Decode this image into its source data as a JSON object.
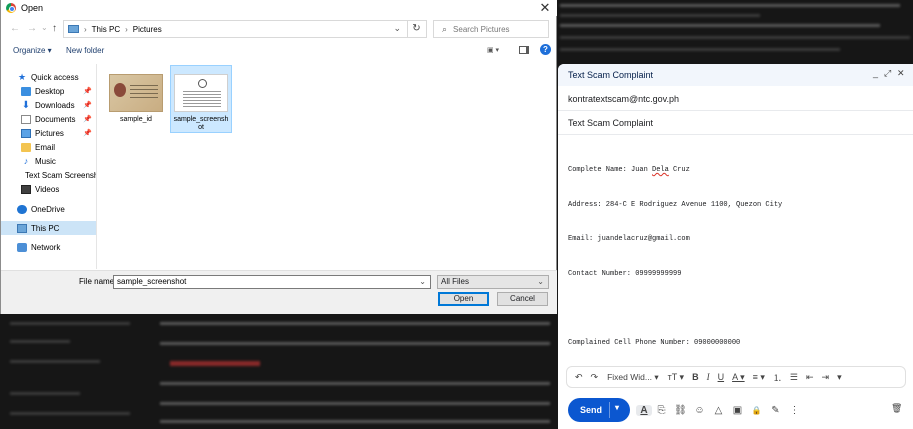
{
  "dialog": {
    "title": "Open",
    "close": "✕",
    "nav_back": "←",
    "nav_forward": "→",
    "nav_dropdown": "⌄",
    "nav_up": "↑",
    "breadcrumb": [
      "This PC",
      "Pictures"
    ],
    "breadcrumb_sep": "›",
    "address_dropdown": "⌄",
    "refresh": "↻",
    "search_placeholder": "Search Pictures",
    "organize": "Organize ▾",
    "new_folder": "New folder",
    "view_icon": "▣ ▾",
    "help": "?",
    "nav_items": [
      {
        "label": "Quick access",
        "icon": "star-icon",
        "glyph": "★",
        "pinned": false
      },
      {
        "label": "Desktop",
        "icon": "desktop-icon",
        "pinned": true
      },
      {
        "label": "Downloads",
        "icon": "download-icon",
        "glyph": "⬇",
        "pinned": true
      },
      {
        "label": "Documents",
        "icon": "documents-icon",
        "pinned": true
      },
      {
        "label": "Pictures",
        "icon": "pictures-icon",
        "pinned": true
      },
      {
        "label": "Email",
        "icon": "folder-icon",
        "pinned": false
      },
      {
        "label": "Music",
        "icon": "music-icon",
        "glyph": "♪",
        "pinned": false
      },
      {
        "label": "Text Scam Screensh",
        "icon": "folder-icon",
        "pinned": false
      },
      {
        "label": "Videos",
        "icon": "videos-icon",
        "pinned": false
      },
      {
        "label": "OneDrive",
        "icon": "cloud-icon",
        "pinned": false
      },
      {
        "label": "This PC",
        "icon": "pc-icon",
        "pinned": false,
        "selected": true
      },
      {
        "label": "Network",
        "icon": "network-icon",
        "pinned": false
      }
    ],
    "pin_glyph": "📌",
    "files": [
      {
        "name": "sample_id",
        "thumb": "id-card",
        "selected": false
      },
      {
        "name": "sample_screensh ot",
        "thumb": "screenshot",
        "selected": true
      }
    ],
    "filename_label": "File name:",
    "filename_value": "sample_screenshot",
    "filter_value": "All Files",
    "open_button": "Open",
    "cancel_button": "Cancel",
    "dropdown_glyph": "⌄"
  },
  "compose": {
    "title": "Text Scam Complaint",
    "minimize": "_",
    "expand": "⤢",
    "close": "✕",
    "to": "kontratextscam@ntc.gov.ph",
    "subject": "Text Scam Complaint",
    "body_lines": [
      {
        "pre": "Complete Name: Juan ",
        "flag": "Dela",
        "post": " Cruz"
      },
      {
        "pre": "Address: 284-C E Rodriguez Avenue 1100, Quezon City",
        "flag": "",
        "post": ""
      },
      {
        "pre": "Email: juandelacruz@gmail.com",
        "flag": "",
        "post": ""
      },
      {
        "pre": "Contact Number: 09999999999",
        "flag": "",
        "post": ""
      },
      {
        "pre": "",
        "flag": "",
        "post": ""
      },
      {
        "pre": "Complained Cell Phone Number: 09000000000",
        "flag": "",
        "post": ""
      }
    ],
    "toolbar": {
      "undo": "↶",
      "redo": "↷",
      "font": "Fixed Wid... ▾",
      "size": "тT ▾",
      "bold": "B",
      "italic": "I",
      "underline": "U",
      "color": "A ▾",
      "align": "≡ ▾",
      "numbered": "⒈",
      "bulleted": "☰",
      "indent_less": "⇤",
      "indent_more": "⇥",
      "more": "▾"
    },
    "send": "Send",
    "send_options": "▾",
    "actions": {
      "format": "A",
      "attach": "⎘",
      "link": "⛓",
      "emoji": "☺",
      "drive": "△",
      "photo": "▣",
      "lock": "🔒",
      "signature": "✎",
      "more": "⋮"
    },
    "discard": "🗑"
  }
}
